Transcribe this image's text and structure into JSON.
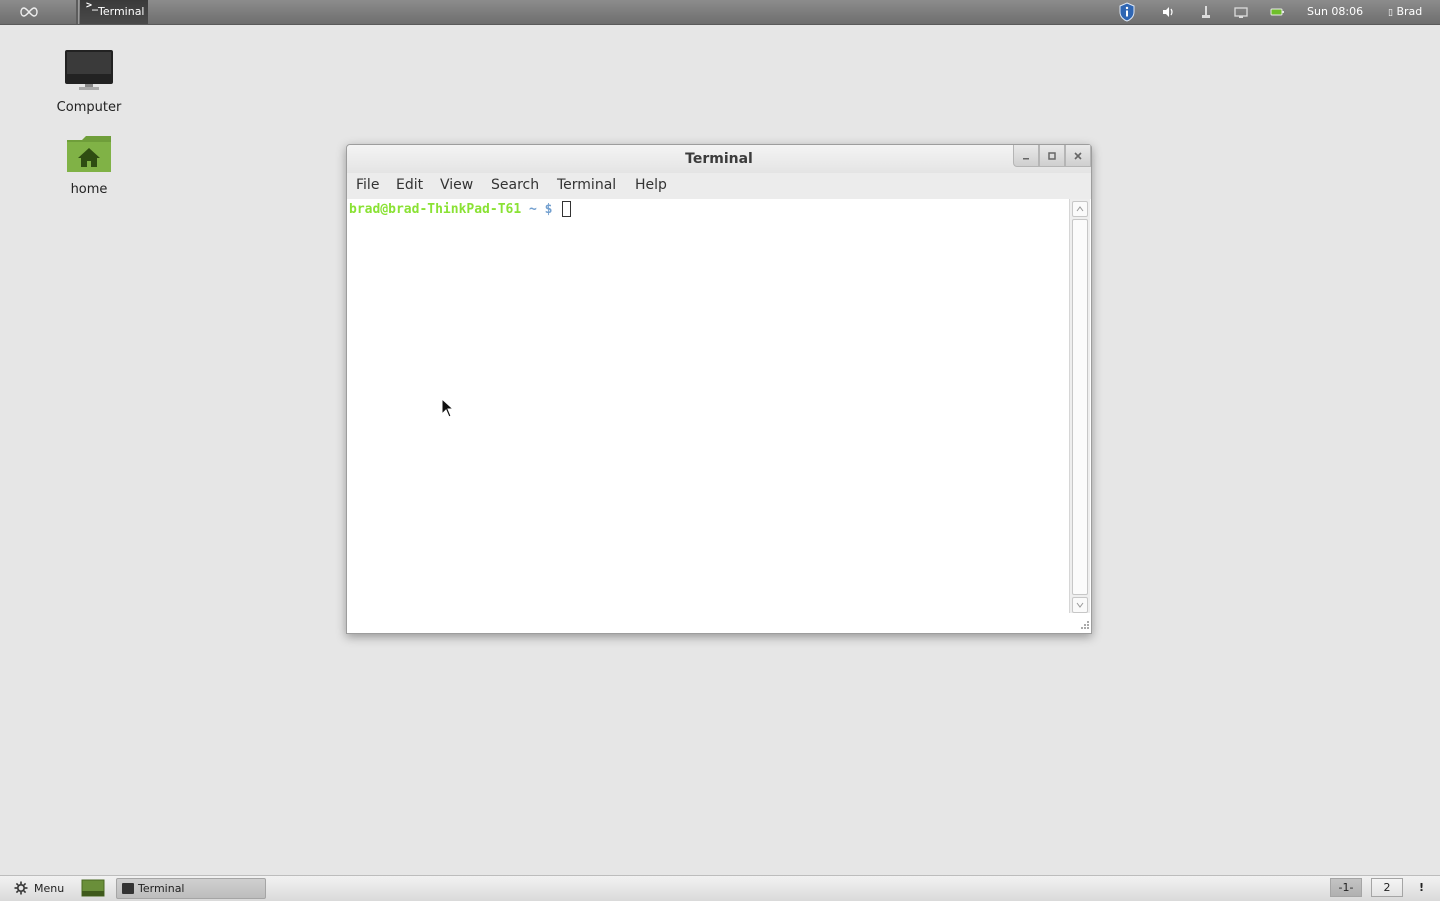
{
  "top_panel": {
    "launcher_icon": "mint-menu-icon",
    "task_label": "Terminal",
    "task_glyph": ">_",
    "tray_icons": [
      "update-shield-icon",
      "volume-icon",
      "network-icon",
      "display-icon",
      "battery-icon"
    ],
    "clock": "Sun 08:06",
    "user": "Brad"
  },
  "desktop": {
    "icons": [
      {
        "label": "Computer",
        "icon": "computer-monitor-icon"
      },
      {
        "label": "home",
        "icon": "home-folder-icon"
      }
    ]
  },
  "terminal": {
    "title": "Terminal",
    "menus": [
      "File",
      "Edit",
      "View",
      "Search",
      "Terminal",
      "Help"
    ],
    "prompt_user": "brad@brad-ThinkPad-T61",
    "prompt_path": "~ $",
    "colors": {
      "user": "#8ae234",
      "path": "#729fcf"
    }
  },
  "bottom_panel": {
    "menu_label": "Menu",
    "task_label": "Terminal",
    "workspaces": [
      "-1-",
      "2"
    ],
    "notification": "!"
  }
}
